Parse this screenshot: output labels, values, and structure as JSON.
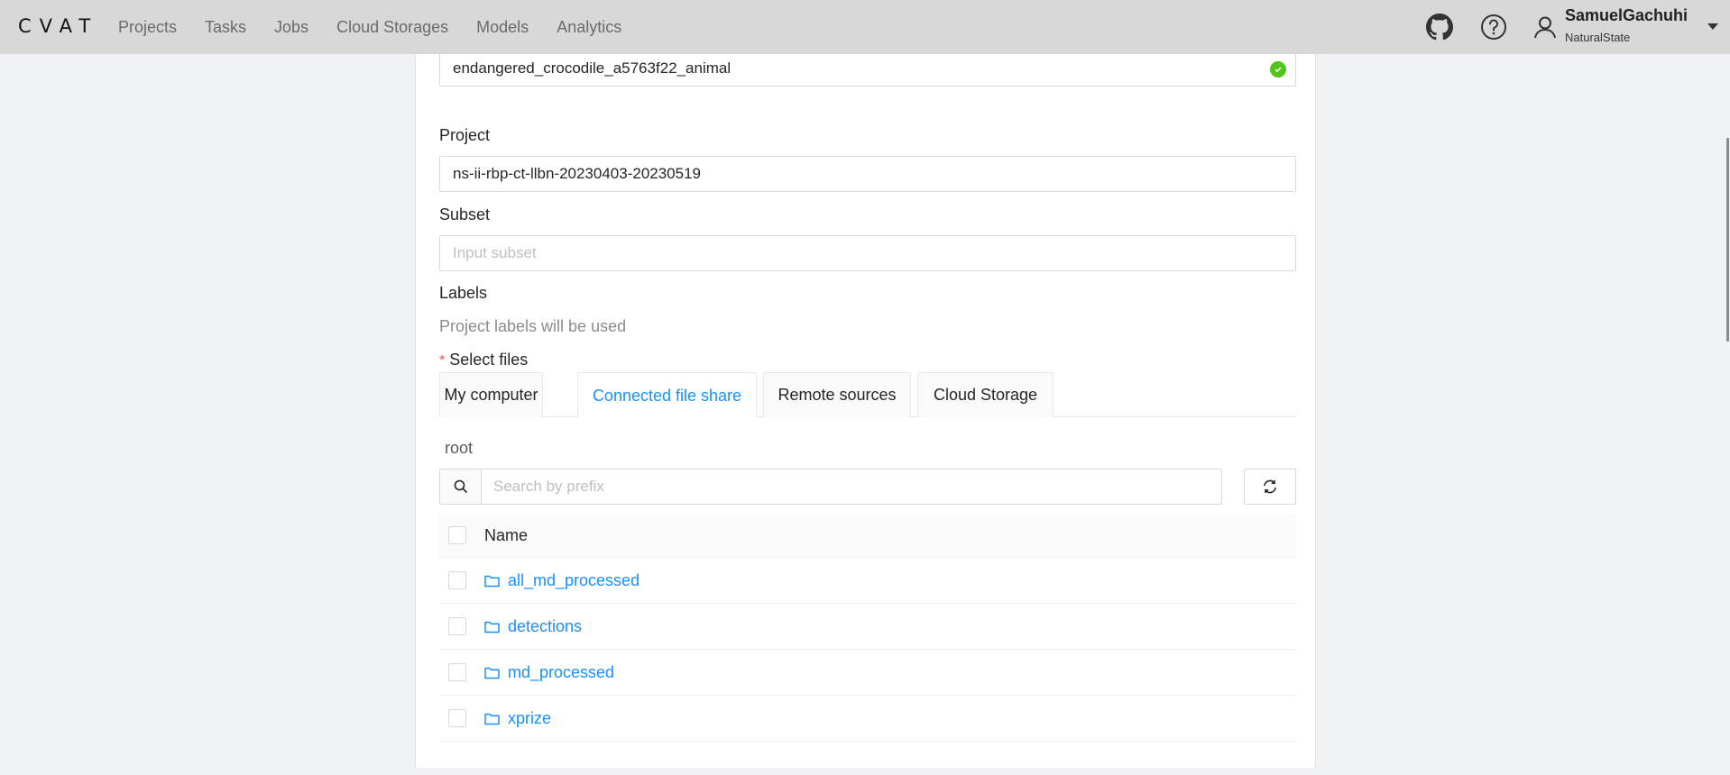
{
  "header": {
    "logo": "CVAT",
    "nav": [
      "Projects",
      "Tasks",
      "Jobs",
      "Cloud Storages",
      "Models",
      "Analytics"
    ],
    "icons": [
      "github-icon",
      "help-icon"
    ],
    "user": {
      "name": "SamuelGachuhi",
      "organization": "NaturalState"
    }
  },
  "form": {
    "task_name": {
      "value": "endangered_crocodile_a5763f22_animal",
      "status": "valid"
    },
    "project": {
      "label": "Project",
      "value": "ns-ii-rbp-ct-llbn-20230403-20230519"
    },
    "subset": {
      "label": "Subset",
      "placeholder": "Input subset"
    },
    "labels": {
      "label": "Labels",
      "hint": "Project labels will be used"
    },
    "select_files": {
      "required_mark": "*",
      "label": "Select files",
      "tabs": [
        {
          "label": "My computer",
          "active": false
        },
        {
          "label": "Connected file share",
          "active": true
        },
        {
          "label": "Remote sources",
          "active": false
        },
        {
          "label": "Cloud Storage",
          "active": false
        }
      ]
    }
  },
  "file_share": {
    "path": "root",
    "search_placeholder": "Search by prefix",
    "table": {
      "columns": [
        "Name"
      ],
      "rows": [
        {
          "name": "all_md_processed",
          "type": "folder",
          "checked": false
        },
        {
          "name": "detections",
          "type": "folder",
          "checked": false
        },
        {
          "name": "md_processed",
          "type": "folder",
          "checked": false
        },
        {
          "name": "xprize",
          "type": "folder",
          "checked": false
        }
      ]
    }
  },
  "colors": {
    "accent": "#1890ff",
    "success": "#52c41a",
    "required": "#ff4d4f",
    "header_bg": "#d8d8d8",
    "page_bg": "#f0f2f5"
  }
}
